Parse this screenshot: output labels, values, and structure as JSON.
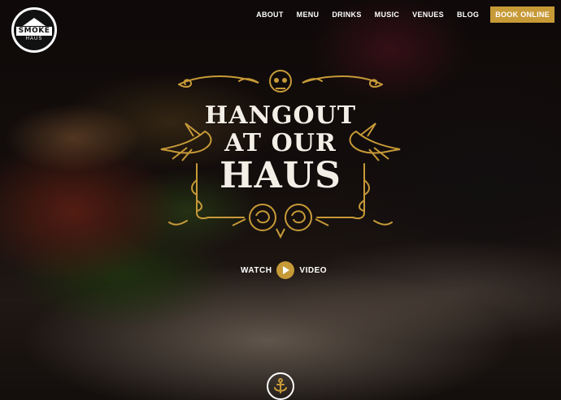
{
  "logo": {
    "main": "SMOKE",
    "sub": "HAUS"
  },
  "nav": {
    "items": [
      {
        "label": "ABOUT"
      },
      {
        "label": "MENU"
      },
      {
        "label": "DRINKS"
      },
      {
        "label": "MUSIC"
      },
      {
        "label": "VENUES"
      },
      {
        "label": "BLOG"
      }
    ],
    "cta": "BOOK ONLINE"
  },
  "hero": {
    "line1": "HANGOUT",
    "line2": "AT OUR",
    "line3": "HAUS"
  },
  "video": {
    "left": "WATCH",
    "right": "VIDEO"
  },
  "icons": {
    "play": "play-icon",
    "anchor": "anchor-icon",
    "skull": "skull-icon",
    "bird": "swallow-icon",
    "rose": "rose-icon"
  },
  "colors": {
    "accent": "#c79a38",
    "text": "#ffffff",
    "title": "#f3efe6"
  }
}
